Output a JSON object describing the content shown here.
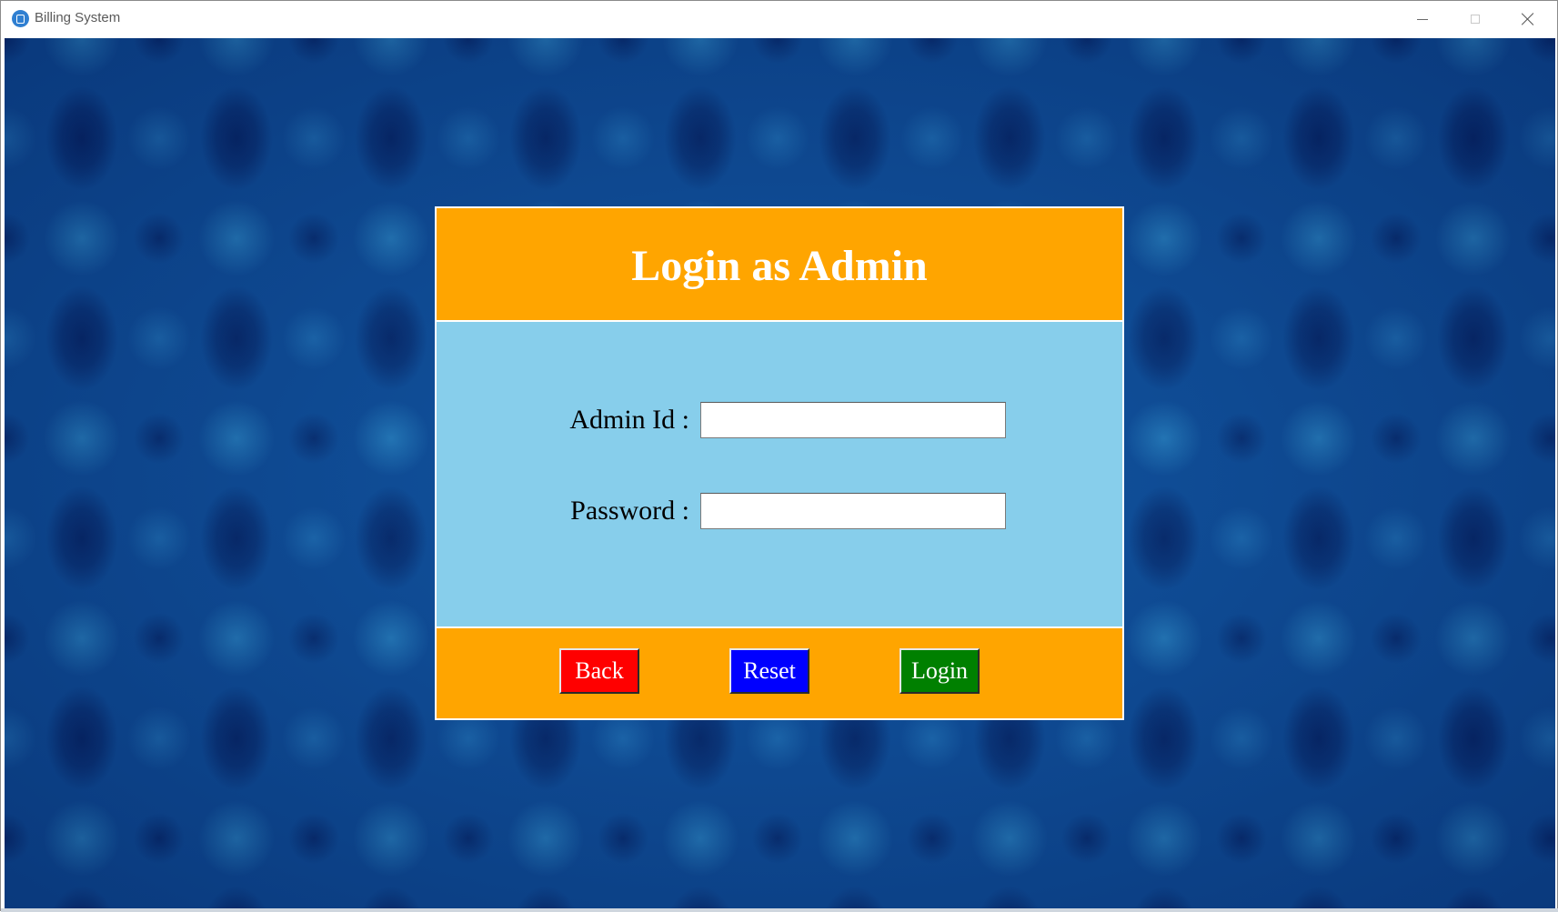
{
  "window": {
    "title": "Billing System",
    "controls": {
      "minimize_icon": "minimize-icon",
      "maximize_icon": "maximize-icon",
      "close_icon": "close-icon"
    }
  },
  "background": {
    "pattern": "blue damask wallpaper",
    "colors": [
      "#0e4d9a",
      "#041c5c",
      "#3caae1"
    ]
  },
  "login": {
    "title": "Login as Admin",
    "fields": {
      "admin_id": {
        "label": "Admin Id :",
        "value": ""
      },
      "password": {
        "label": "Password :",
        "value": ""
      }
    },
    "buttons": {
      "back": "Back",
      "reset": "Reset",
      "login": "Login"
    },
    "colors": {
      "header": "#ffa500",
      "body": "#87ceeb",
      "back_button": "#ff0000",
      "reset_button": "#0000ff",
      "login_button": "#008000"
    }
  }
}
